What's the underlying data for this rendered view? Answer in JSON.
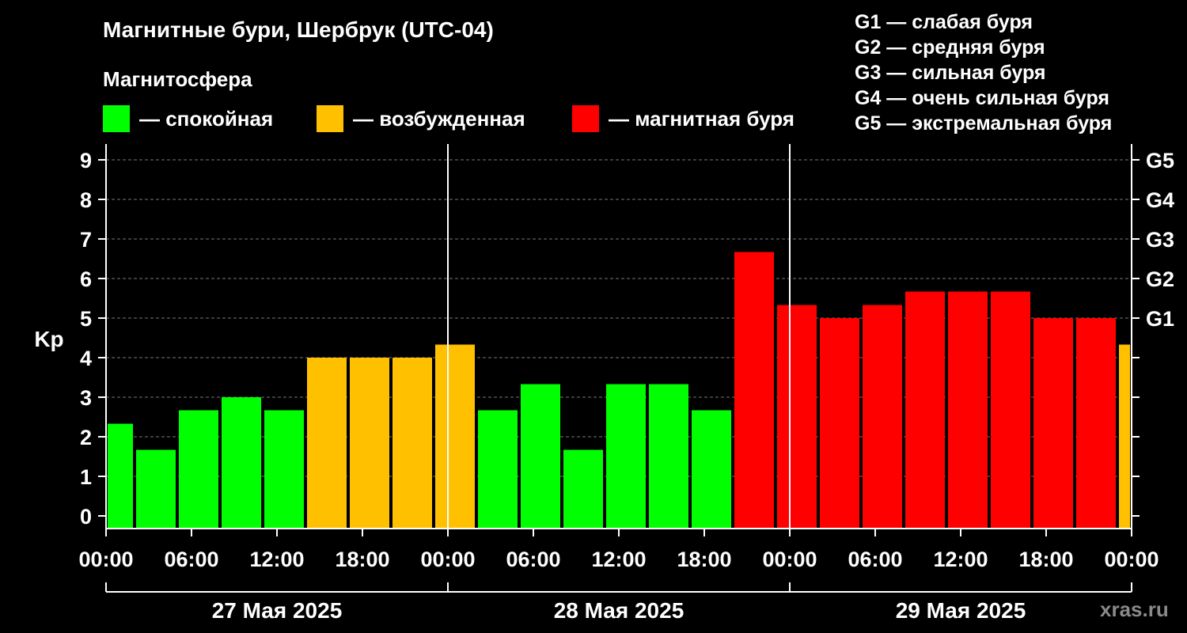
{
  "title": "Магнитные бури, Шербрук (UTC-04)",
  "subtitle": "Магнитосфера",
  "legend": [
    {
      "label": "— спокойная",
      "color": "#00ff00"
    },
    {
      "label": "— возбужденная",
      "color": "#ffc000"
    },
    {
      "label": "— магнитная буря",
      "color": "#ff0000"
    }
  ],
  "g_scale": [
    "G1 — слабая буря",
    "G2 — средняя буря",
    "G3 — сильная буря",
    "G4 — очень сильная буря",
    "G5 — экстремальная буря"
  ],
  "watermark": "xras.ru",
  "chart_data": {
    "type": "bar",
    "ylabel": "Kp",
    "ylim": [
      0,
      9
    ],
    "y_ticks": [
      "0",
      "1",
      "2",
      "3",
      "4",
      "5",
      "6",
      "7",
      "8",
      "9"
    ],
    "right_ticks": [
      {
        "value": 5,
        "label": "G1"
      },
      {
        "value": 6,
        "label": "G2"
      },
      {
        "value": 7,
        "label": "G3"
      },
      {
        "value": 8,
        "label": "G4"
      },
      {
        "value": 9,
        "label": "G5"
      }
    ],
    "x_range_hours": [
      0,
      72
    ],
    "x_ticks": [
      {
        "hour": 0,
        "label": "00:00"
      },
      {
        "hour": 6,
        "label": "06:00"
      },
      {
        "hour": 12,
        "label": "12:00"
      },
      {
        "hour": 18,
        "label": "18:00"
      },
      {
        "hour": 24,
        "label": "00:00"
      },
      {
        "hour": 30,
        "label": "06:00"
      },
      {
        "hour": 36,
        "label": "12:00"
      },
      {
        "hour": 42,
        "label": "18:00"
      },
      {
        "hour": 48,
        "label": "00:00"
      },
      {
        "hour": 54,
        "label": "06:00"
      },
      {
        "hour": 60,
        "label": "12:00"
      },
      {
        "hour": 66,
        "label": "18:00"
      },
      {
        "hour": 72,
        "label": "00:00"
      }
    ],
    "days": [
      {
        "label": "27 Мая 2025",
        "start": 0,
        "end": 24
      },
      {
        "label": "28 Мая 2025",
        "start": 24,
        "end": 48
      },
      {
        "label": "29 Мая 2025",
        "start": 48,
        "end": 72
      }
    ],
    "day_separators": [
      24,
      48
    ],
    "bars": [
      {
        "start": 0,
        "end": 2,
        "kp": 2.33,
        "level": "quiet"
      },
      {
        "start": 2,
        "end": 5,
        "kp": 1.67,
        "level": "quiet"
      },
      {
        "start": 5,
        "end": 8,
        "kp": 2.67,
        "level": "quiet"
      },
      {
        "start": 8,
        "end": 11,
        "kp": 3.0,
        "level": "quiet"
      },
      {
        "start": 11,
        "end": 14,
        "kp": 2.67,
        "level": "quiet"
      },
      {
        "start": 14,
        "end": 17,
        "kp": 4.0,
        "level": "active"
      },
      {
        "start": 17,
        "end": 20,
        "kp": 4.0,
        "level": "active"
      },
      {
        "start": 20,
        "end": 23,
        "kp": 4.0,
        "level": "active"
      },
      {
        "start": 23,
        "end": 26,
        "kp": 4.33,
        "level": "active"
      },
      {
        "start": 26,
        "end": 29,
        "kp": 2.67,
        "level": "quiet"
      },
      {
        "start": 29,
        "end": 32,
        "kp": 3.33,
        "level": "quiet"
      },
      {
        "start": 32,
        "end": 35,
        "kp": 1.67,
        "level": "quiet"
      },
      {
        "start": 35,
        "end": 38,
        "kp": 3.33,
        "level": "quiet"
      },
      {
        "start": 38,
        "end": 41,
        "kp": 3.33,
        "level": "quiet"
      },
      {
        "start": 41,
        "end": 44,
        "kp": 2.67,
        "level": "quiet"
      },
      {
        "start": 44,
        "end": 47,
        "kp": 6.67,
        "level": "storm"
      },
      {
        "start": 47,
        "end": 50,
        "kp": 5.33,
        "level": "storm"
      },
      {
        "start": 50,
        "end": 53,
        "kp": 5.0,
        "level": "storm"
      },
      {
        "start": 53,
        "end": 56,
        "kp": 5.33,
        "level": "storm"
      },
      {
        "start": 56,
        "end": 59,
        "kp": 5.67,
        "level": "storm"
      },
      {
        "start": 59,
        "end": 62,
        "kp": 5.67,
        "level": "storm"
      },
      {
        "start": 62,
        "end": 65,
        "kp": 5.67,
        "level": "storm"
      },
      {
        "start": 65,
        "end": 68,
        "kp": 5.0,
        "level": "storm"
      },
      {
        "start": 68,
        "end": 71,
        "kp": 5.0,
        "level": "storm"
      },
      {
        "start": 71,
        "end": 72,
        "kp": 4.33,
        "level": "active"
      }
    ],
    "level_colors": {
      "quiet": "#00ff00",
      "active": "#ffc000",
      "storm": "#ff0000"
    },
    "grid": "dashed horizontal"
  }
}
